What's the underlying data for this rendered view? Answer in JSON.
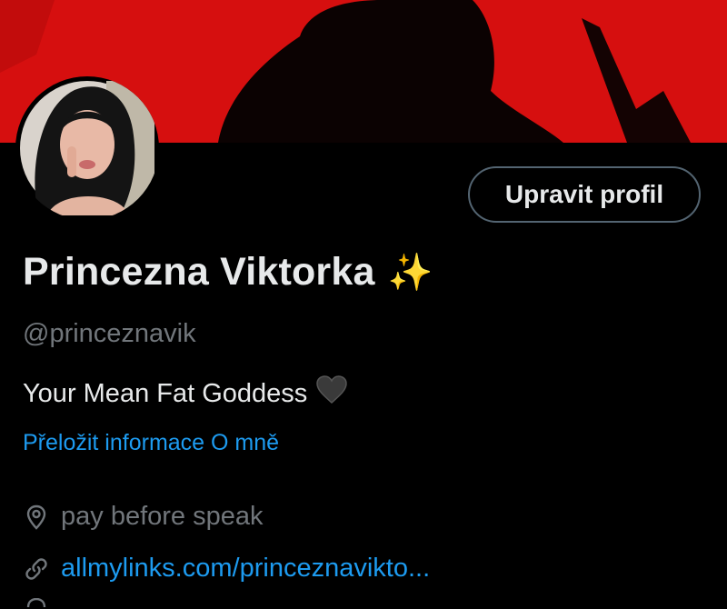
{
  "profile": {
    "display_name": "Princezna Viktorka",
    "name_emoji": "✨",
    "handle": "@princeznavik",
    "bio": "Your Mean Fat Goddess",
    "bio_emoji_icon": "black-heart-icon",
    "translate_link": "Přeložit informace O mně",
    "location": "pay before speak",
    "website": "allmylinks.com/princeznavikto..."
  },
  "actions": {
    "edit_profile": "Upravit profil"
  },
  "colors": {
    "banner": "#d60f0f",
    "link": "#1d9bf0",
    "secondary_text": "#71767b",
    "primary_text": "#e7e9ea",
    "button_border": "#536471"
  }
}
